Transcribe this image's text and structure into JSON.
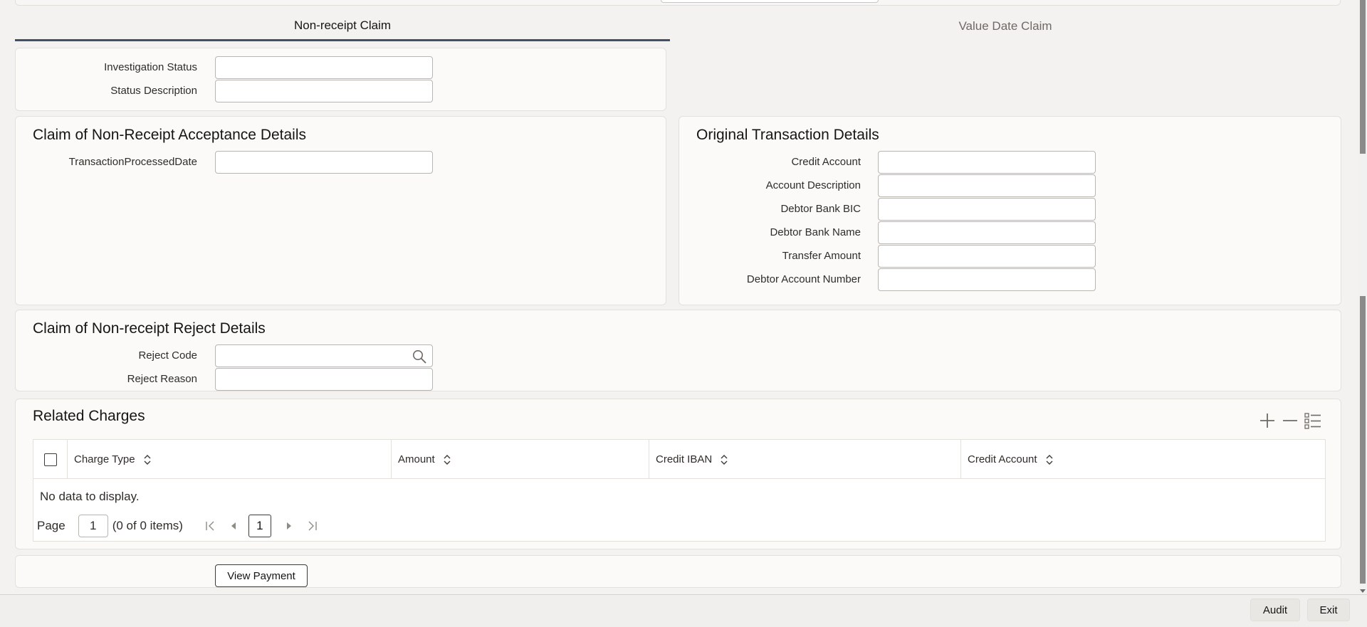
{
  "tabs": [
    {
      "label": "Non-receipt Claim",
      "active": true
    },
    {
      "label": "Value Date Claim",
      "active": false
    }
  ],
  "investigation": {
    "status_label": "Investigation Status",
    "status_value": "",
    "description_label": "Status Description",
    "description_value": ""
  },
  "acceptance": {
    "title": "Claim of Non-Receipt Acceptance Details",
    "processed_date_label": "TransactionProcessedDate",
    "processed_date_value": ""
  },
  "original": {
    "title": "Original Transaction Details",
    "credit_account_label": "Credit Account",
    "account_description_label": "Account Description",
    "debtor_bank_bic_label": "Debtor Bank BIC",
    "debtor_bank_name_label": "Debtor Bank Name",
    "transfer_amount_label": "Transfer Amount",
    "debtor_account_number_label": "Debtor Account Number"
  },
  "reject": {
    "title": "Claim of Non-receipt Reject Details",
    "reject_code_label": "Reject Code",
    "reject_reason_label": "Reject Reason"
  },
  "charges": {
    "title": "Related Charges",
    "columns": [
      "Charge Type",
      "Amount",
      "Credit IBAN",
      "Credit Account"
    ],
    "empty_text": "No data to display.",
    "pager": {
      "page_label": "Page",
      "page_value": "1",
      "info": "(0 of 0 items)",
      "current_page": "1"
    }
  },
  "actions": {
    "view_payment_label": "View Payment"
  },
  "footer": {
    "audit_label": "Audit",
    "exit_label": "Exit"
  },
  "colors": {
    "tab_active_underline": "#414f68",
    "panel_bg": "#fbfaf9",
    "page_bg": "#f4f2f0"
  }
}
